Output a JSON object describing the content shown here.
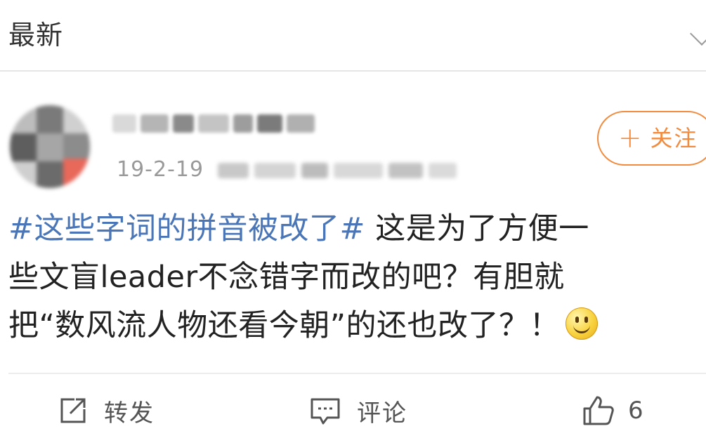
{
  "header": {
    "title": "最新",
    "chevron_icon": "chevron-down-icon"
  },
  "post": {
    "date": "19-2-19",
    "follow_label": "关注",
    "follow_plus": "+",
    "hashtag": "#这些字词的拼音被改了#",
    "text_line1": " 这是为了方便一",
    "text_line2": "些文盲leader不念错字而改的吧？有胆就",
    "text_line3": "把“数风流人物还看今朝”的还也改了？！",
    "emoji": "smile-emoji",
    "colors": {
      "hashtag": "#4a76b8",
      "follow_accent": "#f28b3d"
    }
  },
  "actions": {
    "share_label": "转发",
    "share_icon": "share-icon",
    "comment_label": "评论",
    "comment_icon": "comment-icon",
    "like_count": "6",
    "like_icon": "thumbs-up-icon"
  }
}
